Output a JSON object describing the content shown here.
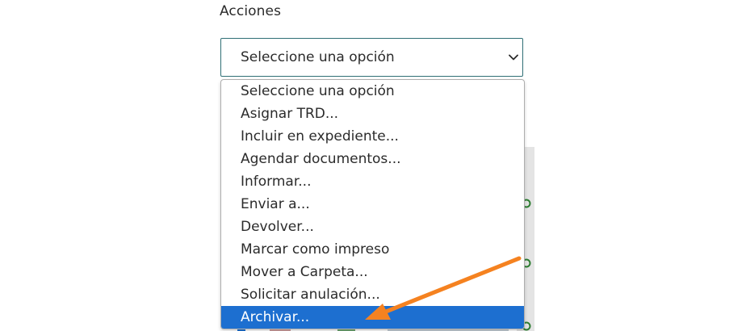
{
  "field": {
    "label": "Acciones",
    "selected_value": "Seleccione una opción",
    "border_color": "#2f6f75"
  },
  "dropdown": {
    "options": [
      {
        "label": "Seleccione una opción"
      },
      {
        "label": "Asignar TRD..."
      },
      {
        "label": "Incluir en expediente..."
      },
      {
        "label": "Agendar documentos..."
      },
      {
        "label": "Informar..."
      },
      {
        "label": "Enviar a..."
      },
      {
        "label": "Devolver..."
      },
      {
        "label": "Marcar como impreso"
      },
      {
        "label": "Mover a Carpeta..."
      },
      {
        "label": "Solicitar anulación..."
      },
      {
        "label": "Archivar..."
      }
    ],
    "highlighted_index": 10,
    "highlight_color": "#1d6fd0"
  },
  "annotation": {
    "arrow_color": "#f58220",
    "arrow_points_to": "Archivar..."
  }
}
